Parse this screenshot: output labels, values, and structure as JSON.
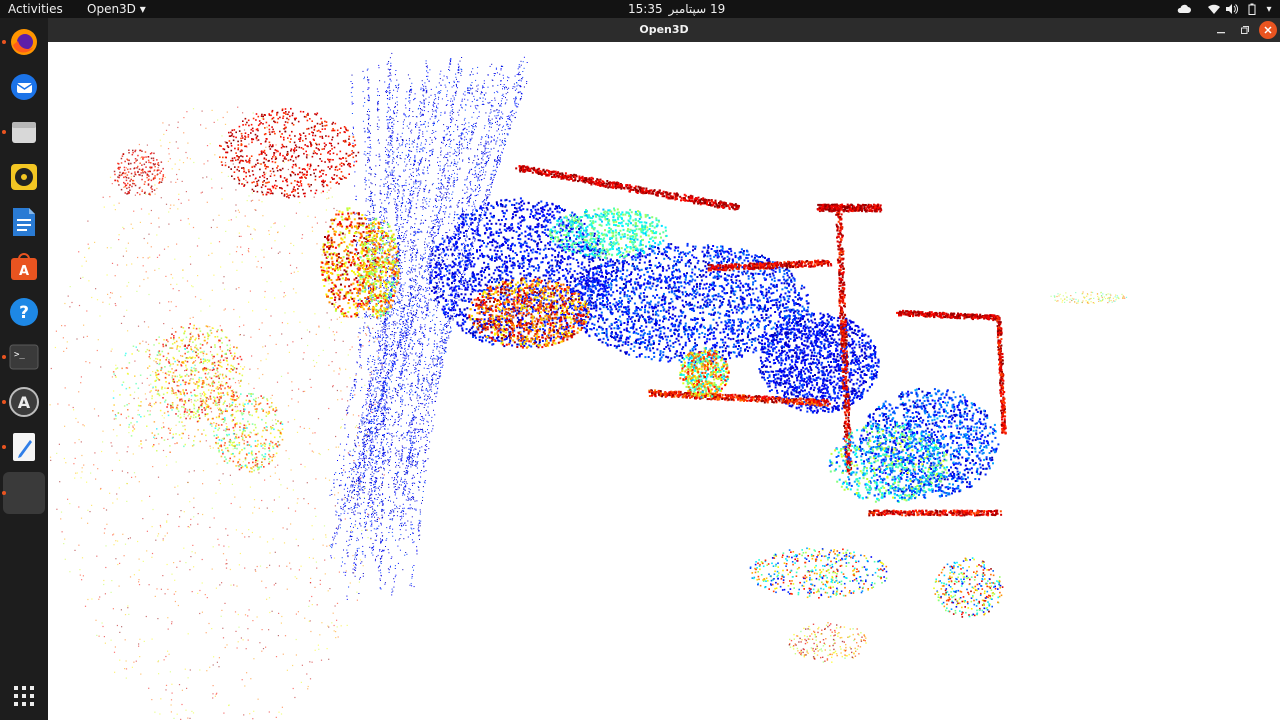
{
  "topbar": {
    "activities": "Activities",
    "app_menu": "Open3D",
    "time": "15:35",
    "date": "19 سپتامبر"
  },
  "dock": {
    "items": [
      {
        "name": "firefox",
        "glyph": "",
        "running": true
      },
      {
        "name": "thunderbird",
        "glyph": "",
        "running": false
      },
      {
        "name": "files",
        "glyph": "",
        "running": true
      },
      {
        "name": "rhythmbox",
        "glyph": "",
        "running": false
      },
      {
        "name": "libreoffice-writer",
        "glyph": "",
        "running": false
      },
      {
        "name": "ubuntu-software",
        "glyph": "A",
        "running": false
      },
      {
        "name": "help",
        "glyph": "?",
        "running": false
      },
      {
        "name": "terminal",
        "glyph": ">_",
        "running": true
      },
      {
        "name": "software-updater",
        "glyph": "A",
        "running": true
      },
      {
        "name": "text-editor",
        "glyph": "",
        "running": true
      },
      {
        "name": "open3d-app",
        "glyph": "",
        "running": true
      }
    ],
    "show_apps_glyph": "⋮⋮⋮"
  },
  "window": {
    "title": "Open3D"
  },
  "colors": {
    "topbar_bg": "#131313",
    "dock_bg": "#1d1d1d",
    "titlebar_bg": "#2c2c2c",
    "close_button": "#e95420",
    "viewport_bg": "#ffffff"
  }
}
